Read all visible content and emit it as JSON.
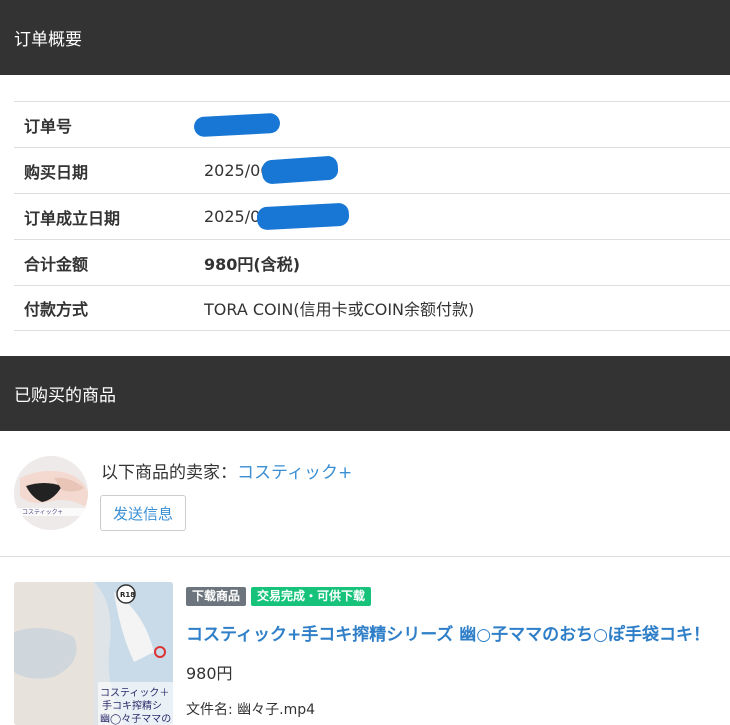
{
  "sections": {
    "order_summary": "订单概要",
    "purchased_products": "已购买的商品"
  },
  "order": {
    "rows": [
      {
        "label": "订单号",
        "value": ""
      },
      {
        "label": "购买日期",
        "value": "2025/06/"
      },
      {
        "label": "订单成立日期",
        "value": "2025/06/"
      },
      {
        "label": "合计金额",
        "value": "980円(含税)"
      },
      {
        "label": "付款方式",
        "value": "TORA COIN(信用卡或COIN余额付款)"
      }
    ]
  },
  "seller": {
    "prefix": "以下商品的卖家：",
    "name": "コスティック+",
    "message_button": "发送信息"
  },
  "product": {
    "badges": [
      "下载商品",
      "交易完成・可供下载"
    ],
    "title": "コスティック+手コキ搾精シリーズ 幽○子ママのおち○ぽ手袋コキ！",
    "price": "980円",
    "file": "文件名: 幽々子.mp4",
    "thumb_rating": "R18",
    "thumb_text": "コスティック＋ 手コキ搾精シ 幽◯々子ママの"
  },
  "colors": {
    "header_bg": "#333333",
    "link": "#2f7fc8",
    "badge_gray": "#6c757d",
    "badge_green": "#17c37b",
    "redaction": "#1877d4"
  }
}
